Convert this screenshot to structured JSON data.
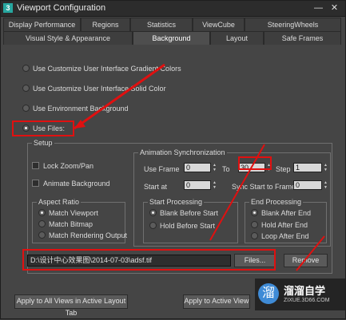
{
  "window": {
    "title": "Viewport Configuration",
    "minimize": "—",
    "close": "✕"
  },
  "tabs_row1": [
    "Display Performance",
    "Regions",
    "Statistics",
    "ViewCube",
    "SteeringWheels"
  ],
  "tabs_row2": [
    "Visual Style & Appearance",
    "Background",
    "Layout",
    "Safe Frames"
  ],
  "active_tab": "Background",
  "background_options": [
    {
      "label": "Use Customize User Interface Gradient Colors",
      "selected": false
    },
    {
      "label": "Use Customize User Interface Solid Color",
      "selected": false
    },
    {
      "label": "Use Environment Background",
      "selected": false
    },
    {
      "label": "Use Files:",
      "selected": true
    }
  ],
  "setup": {
    "title": "Setup",
    "lock_zoom_pan": "Lock Zoom/Pan",
    "animate_background": "Animate Background",
    "aspect_ratio": {
      "title": "Aspect Ratio",
      "options": [
        "Match Viewport",
        "Match Bitmap",
        "Match Rendering Output"
      ],
      "selected": 0
    },
    "anim_sync": {
      "title": "Animation Synchronization",
      "use_frame_label": "Use Frame",
      "use_frame_value": "0",
      "to_label": "To",
      "to_value": "30",
      "step_label": "Step",
      "step_value": "1",
      "start_at_label": "Start at",
      "start_at_value": "0",
      "sync_start_label": "Sync Start to Frame",
      "sync_start_value": "0"
    },
    "start_processing": {
      "title": "Start Processing",
      "options": [
        "Blank Before Start",
        "Hold Before Start"
      ],
      "selected": 0
    },
    "end_processing": {
      "title": "End Processing",
      "options": [
        "Blank After End",
        "Hold After End",
        "Loop After End"
      ],
      "selected": 0
    }
  },
  "file": {
    "path": "D:\\设计中心效果图\\2014-07-03\\adsf.tif",
    "files_button": "Files...",
    "remove_button": "Remove"
  },
  "bottom_buttons": {
    "apply_all": "Apply to All Views in Active Layout Tab",
    "apply_active": "Apply to Active View"
  },
  "watermark": {
    "logo_glyph": "溜",
    "title": "溜溜自学",
    "subtitle": "ZIXUE.3D66.COM"
  },
  "colors": {
    "highlight": "#e01010",
    "dialog_bg": "#454545",
    "watermark_logo": "#3f8bd6"
  }
}
